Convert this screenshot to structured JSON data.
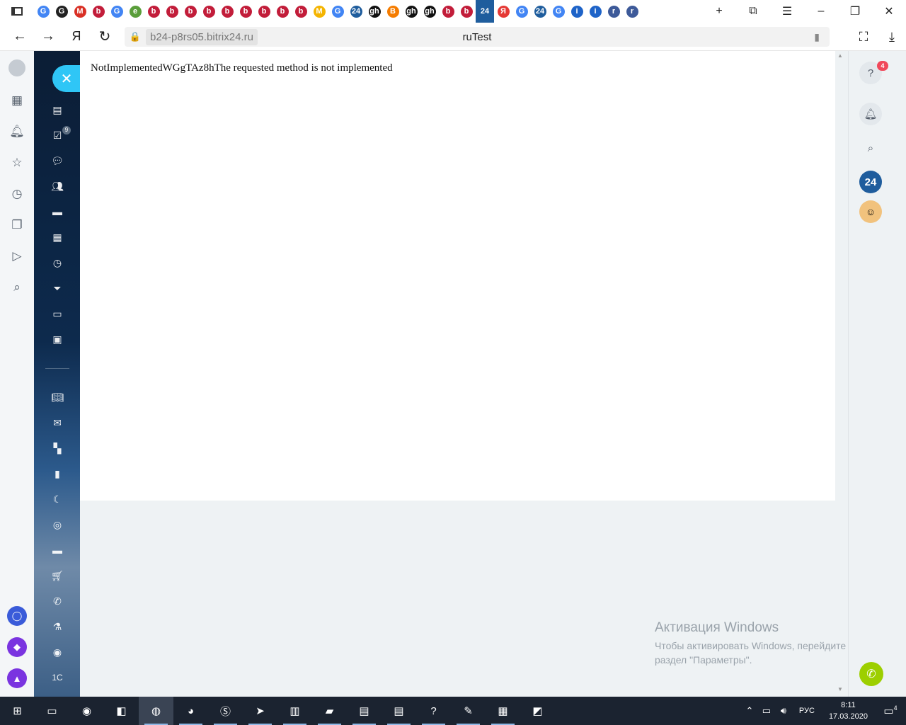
{
  "browser": {
    "address_domain": "b24-p8rs05.bitrix24.ru",
    "page_title": "ruTest",
    "yandex_letter": "Я",
    "tab_labels": [
      "G",
      "G",
      "M",
      "b",
      "G",
      "e",
      "b",
      "b",
      "b",
      "b",
      "b",
      "b",
      "b",
      "b",
      "b",
      "M",
      "G",
      "24",
      "gh",
      "B",
      "gh",
      "gh",
      "b",
      "b",
      "24",
      "Я",
      "G",
      "24",
      "G",
      "i",
      "i",
      "r",
      "r"
    ],
    "tab_colors": [
      "#4285f4",
      "#222222",
      "#d93025",
      "#c21d3a",
      "#4285f4",
      "#5a9e3a",
      "#c21d3a",
      "#c21d3a",
      "#c21d3a",
      "#c21d3a",
      "#c21d3a",
      "#c21d3a",
      "#c21d3a",
      "#c21d3a",
      "#c21d3a",
      "#f4b400",
      "#4285f4",
      "#1f5d9d",
      "#111111",
      "#f57c00",
      "#111111",
      "#111111",
      "#c21d3a",
      "#c21d3a",
      "#1f5d9d",
      "#e53935",
      "#4285f4",
      "#1f5d9d",
      "#4285f4",
      "#1e63c8",
      "#1e63c8",
      "#3d5a99",
      "#3d5a99"
    ]
  },
  "content": {
    "error_message": "NotImplementedWGgTAz8hThe requested method is not implemented"
  },
  "sidebar": {
    "tasks_badge": "9"
  },
  "right_panel": {
    "help_badge": "4",
    "b24_label": "24"
  },
  "watermark": {
    "title": "Активация Windows",
    "text": "Чтобы активировать Windows, перейдите в раздел \"Параметры\"."
  },
  "taskbar": {
    "language": "РУС",
    "time": "8:11",
    "date": "17.03.2020",
    "notification_count": "4"
  }
}
